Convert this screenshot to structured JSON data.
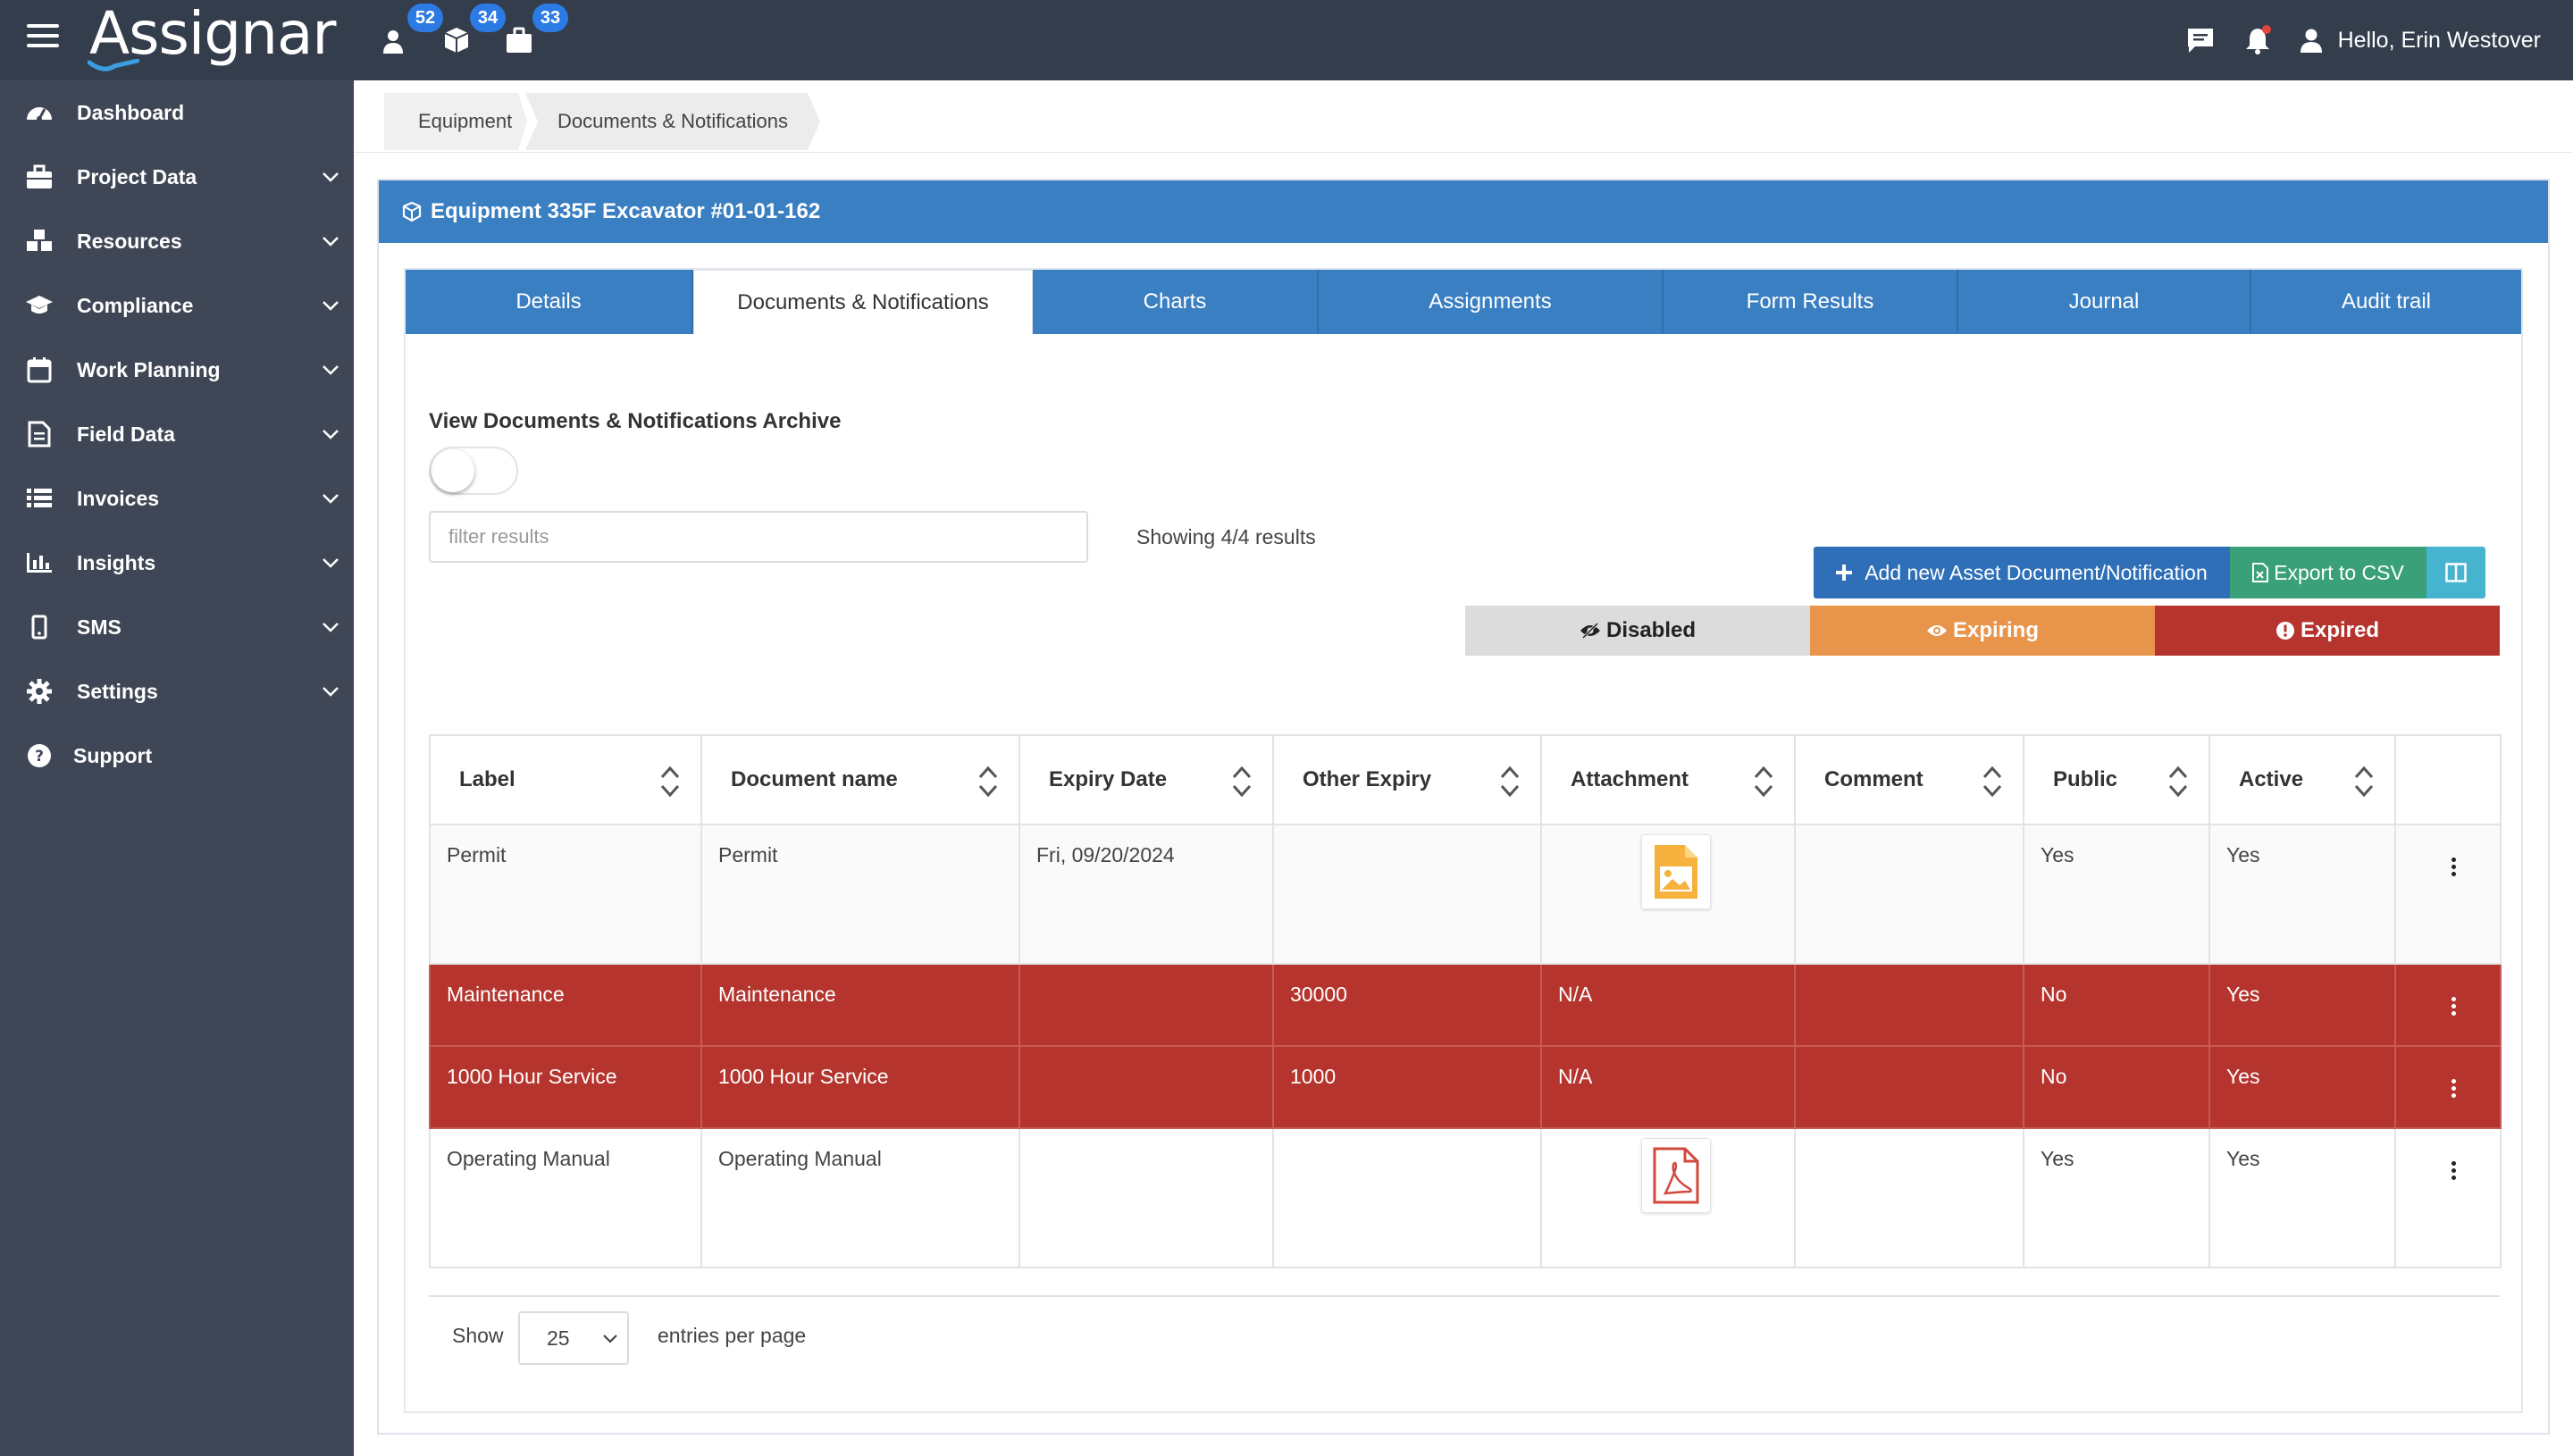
{
  "app": {
    "logo_text": "Assignar",
    "greeting": "Hello, Erin Westover"
  },
  "topbar": {
    "badges": [
      {
        "icon": "user-icon",
        "count": "52"
      },
      {
        "icon": "cube-icon",
        "count": "34"
      },
      {
        "icon": "briefcase-icon",
        "count": "33"
      }
    ]
  },
  "sidebar": {
    "items": [
      {
        "label": "Dashboard",
        "icon": "dashboard-icon",
        "expandable": false
      },
      {
        "label": "Project Data",
        "icon": "briefcase-icon",
        "expandable": true
      },
      {
        "label": "Resources",
        "icon": "cubes-icon",
        "expandable": true
      },
      {
        "label": "Compliance",
        "icon": "graduation-cap-icon",
        "expandable": true
      },
      {
        "label": "Work Planning",
        "icon": "calendar-icon",
        "expandable": true
      },
      {
        "label": "Field Data",
        "icon": "file-icon",
        "expandable": true
      },
      {
        "label": "Invoices",
        "icon": "list-icon",
        "expandable": true
      },
      {
        "label": "Insights",
        "icon": "bar-chart-icon",
        "expandable": true
      },
      {
        "label": "SMS",
        "icon": "mobile-icon",
        "expandable": true
      },
      {
        "label": "Settings",
        "icon": "gear-icon",
        "expandable": true
      },
      {
        "label": "Support",
        "icon": "question-icon",
        "expandable": false
      }
    ]
  },
  "breadcrumb": [
    "Equipment",
    "Documents & Notifications"
  ],
  "panel": {
    "title": "Equipment 335F Excavator #01-01-162"
  },
  "tabs": [
    {
      "label": "Details",
      "active": false
    },
    {
      "label": "Documents & Notifications",
      "active": true
    },
    {
      "label": "Charts",
      "active": false
    },
    {
      "label": "Assignments",
      "active": false
    },
    {
      "label": "Form Results",
      "active": false
    },
    {
      "label": "Journal",
      "active": false
    },
    {
      "label": "Audit trail",
      "active": false
    }
  ],
  "archive": {
    "label": "View Documents & Notifications Archive",
    "enabled": false
  },
  "filter": {
    "placeholder": "filter results",
    "value": ""
  },
  "showing": "Showing 4/4 results",
  "buttons": {
    "add": "Add new Asset Document/Notification",
    "csv": "Export to CSV"
  },
  "legend": {
    "disabled": "Disabled",
    "expiring": "Expiring",
    "expired": "Expired"
  },
  "colors": {
    "header_bg": "#343d4c",
    "sidebar_bg": "#3f4756",
    "primary": "#3a7fc1",
    "expired": "#b5352e",
    "expiring": "#e9944b",
    "csv": "#3aa07a"
  },
  "table": {
    "columns": [
      "Label",
      "Document name",
      "Expiry Date",
      "Other Expiry",
      "Attachment",
      "Comment",
      "Public",
      "Active"
    ],
    "rows": [
      {
        "label": "Permit",
        "document_name": "Permit",
        "expiry_date": "Fri, 09/20/2024",
        "other_expiry": "",
        "attachment": "image-file-icon",
        "comment": "",
        "public": "Yes",
        "active": "Yes",
        "status": "normal"
      },
      {
        "label": "Maintenance",
        "document_name": "Maintenance",
        "expiry_date": "",
        "other_expiry": "30000",
        "attachment": "N/A",
        "comment": "",
        "public": "No",
        "active": "Yes",
        "status": "expired"
      },
      {
        "label": "1000 Hour Service",
        "document_name": "1000 Hour Service",
        "expiry_date": "",
        "other_expiry": "1000",
        "attachment": "N/A",
        "comment": "",
        "public": "No",
        "active": "Yes",
        "status": "expired"
      },
      {
        "label": "Operating Manual",
        "document_name": "Operating Manual",
        "expiry_date": "",
        "other_expiry": "",
        "attachment": "pdf-file-icon",
        "comment": "",
        "public": "Yes",
        "active": "Yes",
        "status": "normal"
      }
    ]
  },
  "pagination": {
    "show_label": "Show",
    "per_page": "25",
    "entries_label": "entries per page"
  }
}
